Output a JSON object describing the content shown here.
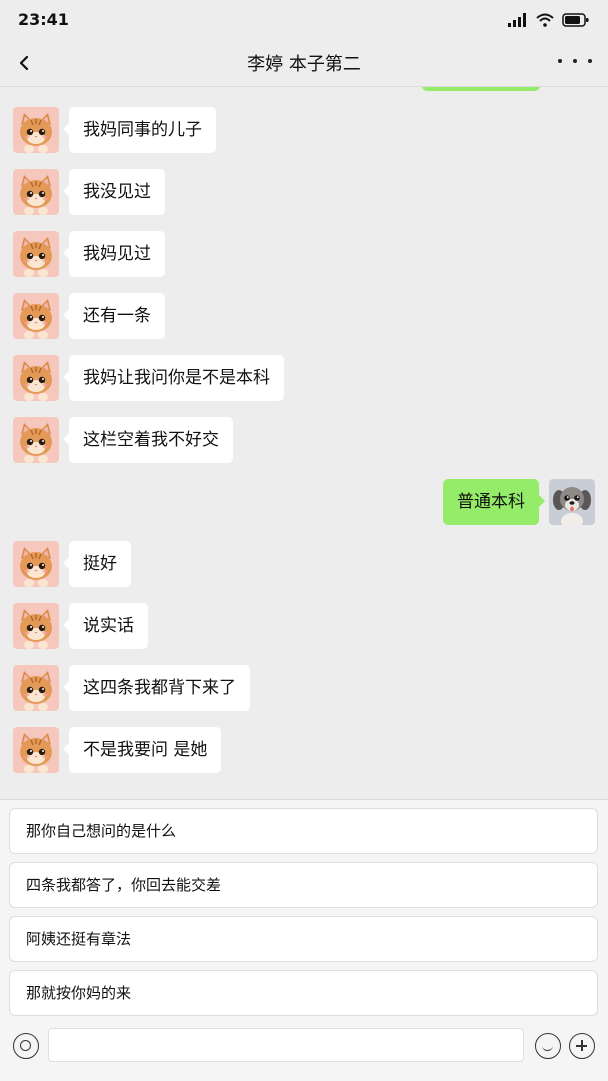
{
  "status_bar": {
    "time": "23:41"
  },
  "header": {
    "title": "李婷 本子第二"
  },
  "colors": {
    "outgoing_bubble": "#95ec69",
    "incoming_bubble": "#ffffff",
    "background": "#ededed"
  },
  "icons": {
    "back": "chevron-left-icon",
    "more": "more-dots-icon",
    "contact_avatar": "kitten-avatar",
    "my_avatar": "puppy-avatar",
    "voice": "voice-icon",
    "emoji": "emoji-icon",
    "plus": "plus-icon"
  },
  "messages": [
    {
      "from": "contact",
      "text": "我妈同事的儿子"
    },
    {
      "from": "contact",
      "text": "我没见过"
    },
    {
      "from": "contact",
      "text": "我妈见过"
    },
    {
      "from": "contact",
      "text": "还有一条"
    },
    {
      "from": "contact",
      "text": "我妈让我问你是不是本科"
    },
    {
      "from": "contact",
      "text": "这栏空着我不好交"
    },
    {
      "from": "me",
      "text": "普通本科"
    },
    {
      "from": "contact",
      "text": "挺好"
    },
    {
      "from": "contact",
      "text": "说实话"
    },
    {
      "from": "contact",
      "text": "这四条我都背下来了"
    },
    {
      "from": "contact",
      "text": "不是我要问 是她"
    }
  ],
  "suggestions": [
    "那你自己想问的是什么",
    "四条我都答了，你回去能交差",
    "阿姨还挺有章法",
    "那就按你妈的来"
  ],
  "input": {
    "value": "",
    "placeholder": ""
  }
}
